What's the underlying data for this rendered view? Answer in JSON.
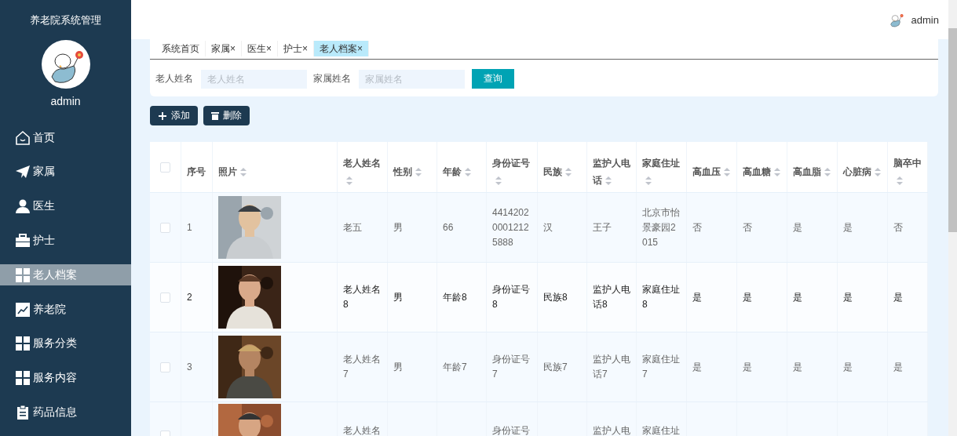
{
  "sidebar": {
    "title": "养老院系统管理",
    "user": "admin",
    "items": [
      {
        "label": "首页",
        "selected": false
      },
      {
        "label": "家属",
        "selected": false
      },
      {
        "label": "医生",
        "selected": false
      },
      {
        "label": "护士",
        "selected": false
      },
      {
        "label": "老人档案",
        "selected": true
      },
      {
        "label": "养老院",
        "selected": false
      },
      {
        "label": "服务分类",
        "selected": false
      },
      {
        "label": "服务内容",
        "selected": false
      },
      {
        "label": "药品信息",
        "selected": false
      }
    ]
  },
  "header": {
    "user": "admin"
  },
  "tabs": [
    {
      "label": "系统首页",
      "selected": false
    },
    {
      "label": "家属",
      "close": "×",
      "selected": false
    },
    {
      "label": "医生",
      "close": "×",
      "selected": false
    },
    {
      "label": "护士",
      "close": "×",
      "selected": false
    },
    {
      "label": "老人档案",
      "close": "×",
      "selected": true
    }
  ],
  "search": {
    "fields": [
      {
        "label": "老人姓名",
        "placeholder": "老人姓名"
      },
      {
        "label": "家属姓名",
        "placeholder": "家属姓名"
      }
    ],
    "button": "查询"
  },
  "actions": [
    {
      "kind": "add",
      "label": "添加"
    },
    {
      "kind": "delete",
      "label": "删除"
    }
  ],
  "table": {
    "all_checked": false,
    "columns": [
      {
        "label": "序号",
        "sortable": false
      },
      {
        "label": "照片",
        "sortable": true
      },
      {
        "label": "老人姓名",
        "sortable": true
      },
      {
        "label": "性别",
        "sortable": true
      },
      {
        "label": "年龄",
        "sortable": true
      },
      {
        "label": "身份证号",
        "sortable": true
      },
      {
        "label": "民族",
        "sortable": true
      },
      {
        "label": "监护人电话",
        "sortable": true
      },
      {
        "label": "家庭住址",
        "sortable": true
      },
      {
        "label": "高血压",
        "sortable": true
      },
      {
        "label": "高血糖",
        "sortable": true
      },
      {
        "label": "高血脂",
        "sortable": true
      },
      {
        "label": "心脏病",
        "sortable": true
      },
      {
        "label": "脑卒中",
        "sortable": true
      }
    ],
    "rows": [
      {
        "checked": false,
        "hovered": false,
        "cells": [
          "1",
          {
            "kind": "picture"
          },
          "老五",
          "男",
          "66",
          "441420200012125888",
          "汉",
          "王子",
          "北京市怡景豪园2015",
          "否",
          "否",
          "是",
          "是",
          "否"
        ]
      },
      {
        "checked": false,
        "hovered": true,
        "cells": [
          "2",
          {
            "kind": "picture"
          },
          "老人姓名8",
          "男",
          "年龄8",
          "身份证号8",
          "民族8",
          "监护人电话8",
          "家庭住址8",
          "是",
          "是",
          "是",
          "是",
          "是"
        ]
      },
      {
        "checked": false,
        "hovered": false,
        "cells": [
          "3",
          {
            "kind": "picture"
          },
          "老人姓名7",
          "男",
          "年龄7",
          "身份证号7",
          "民族7",
          "监护人电话7",
          "家庭住址7",
          "是",
          "是",
          "是",
          "是",
          "是"
        ]
      },
      {
        "checked": false,
        "hovered": false,
        "cells": [
          "",
          {
            "kind": "picture"
          },
          "老人姓名",
          "",
          "",
          "身份证号",
          "",
          "监护人电",
          "家庭住址"
        ]
      }
    ]
  }
}
